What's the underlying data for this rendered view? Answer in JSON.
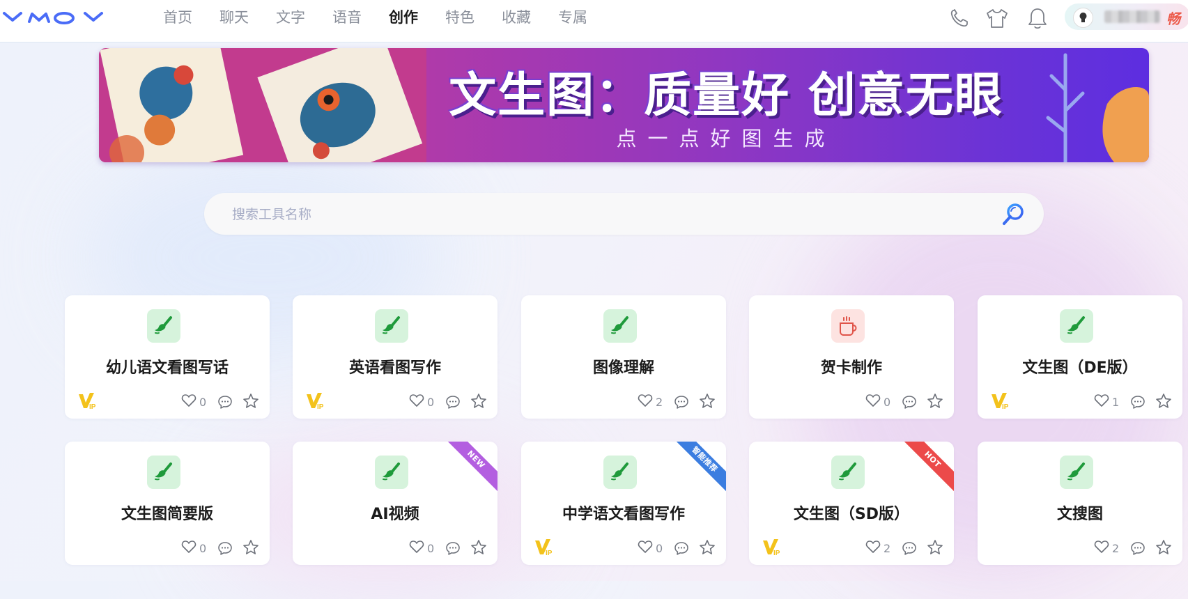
{
  "header": {
    "logo_text": "YMOY",
    "nav": [
      {
        "label": "首页",
        "active": false
      },
      {
        "label": "聊天",
        "active": false
      },
      {
        "label": "文字",
        "active": false
      },
      {
        "label": "语音",
        "active": false
      },
      {
        "label": "创作",
        "active": true
      },
      {
        "label": "特色",
        "active": false
      },
      {
        "label": "收藏",
        "active": false
      },
      {
        "label": "专属",
        "active": false
      }
    ],
    "icons": [
      "phone-icon",
      "shirt-icon",
      "bell-icon"
    ],
    "user": {
      "vip_char": "畅"
    }
  },
  "banner": {
    "title": "文生图：质量好 创意无眼",
    "subtitle": "点一点好图生成"
  },
  "search": {
    "placeholder": "搜索工具名称"
  },
  "cards": [
    {
      "title": "幼儿语文看图写话",
      "likes": "0",
      "vip": true,
      "icon": "brush-icon",
      "ribbon": null
    },
    {
      "title": "英语看图写作",
      "likes": "0",
      "vip": true,
      "icon": "brush-icon",
      "ribbon": null
    },
    {
      "title": "图像理解",
      "likes": "2",
      "vip": false,
      "icon": "brush-icon",
      "ribbon": null
    },
    {
      "title": "贺卡制作",
      "likes": "0",
      "vip": false,
      "icon": "cup-icon",
      "ribbon": null
    },
    {
      "title": "文生图（DE版）",
      "likes": "1",
      "vip": true,
      "icon": "brush-icon",
      "ribbon": null
    },
    {
      "title": "文生图简要版",
      "likes": "0",
      "vip": false,
      "icon": "brush-icon",
      "ribbon": null
    },
    {
      "title": "AI视频",
      "likes": "0",
      "vip": false,
      "icon": "brush-icon",
      "ribbon": "NEW"
    },
    {
      "title": "中学语文看图写作",
      "likes": "0",
      "vip": true,
      "icon": "brush-icon",
      "ribbon": "智能推荐"
    },
    {
      "title": "文生图（SD版）",
      "likes": "2",
      "vip": true,
      "icon": "brush-icon",
      "ribbon": "HOT"
    },
    {
      "title": "文搜图",
      "likes": "2",
      "vip": false,
      "icon": "brush-icon",
      "ribbon": null
    }
  ],
  "colors": {
    "brand_blue": "#4a6cf7",
    "icon_green_bg": "#d6f3dc",
    "icon_green": "#1f9a3b",
    "ribbon_new": "#b35ee0",
    "ribbon_recommend": "#3b7de0",
    "ribbon_hot": "#ec4a4a",
    "vip_yellow": "#f3c21b"
  }
}
